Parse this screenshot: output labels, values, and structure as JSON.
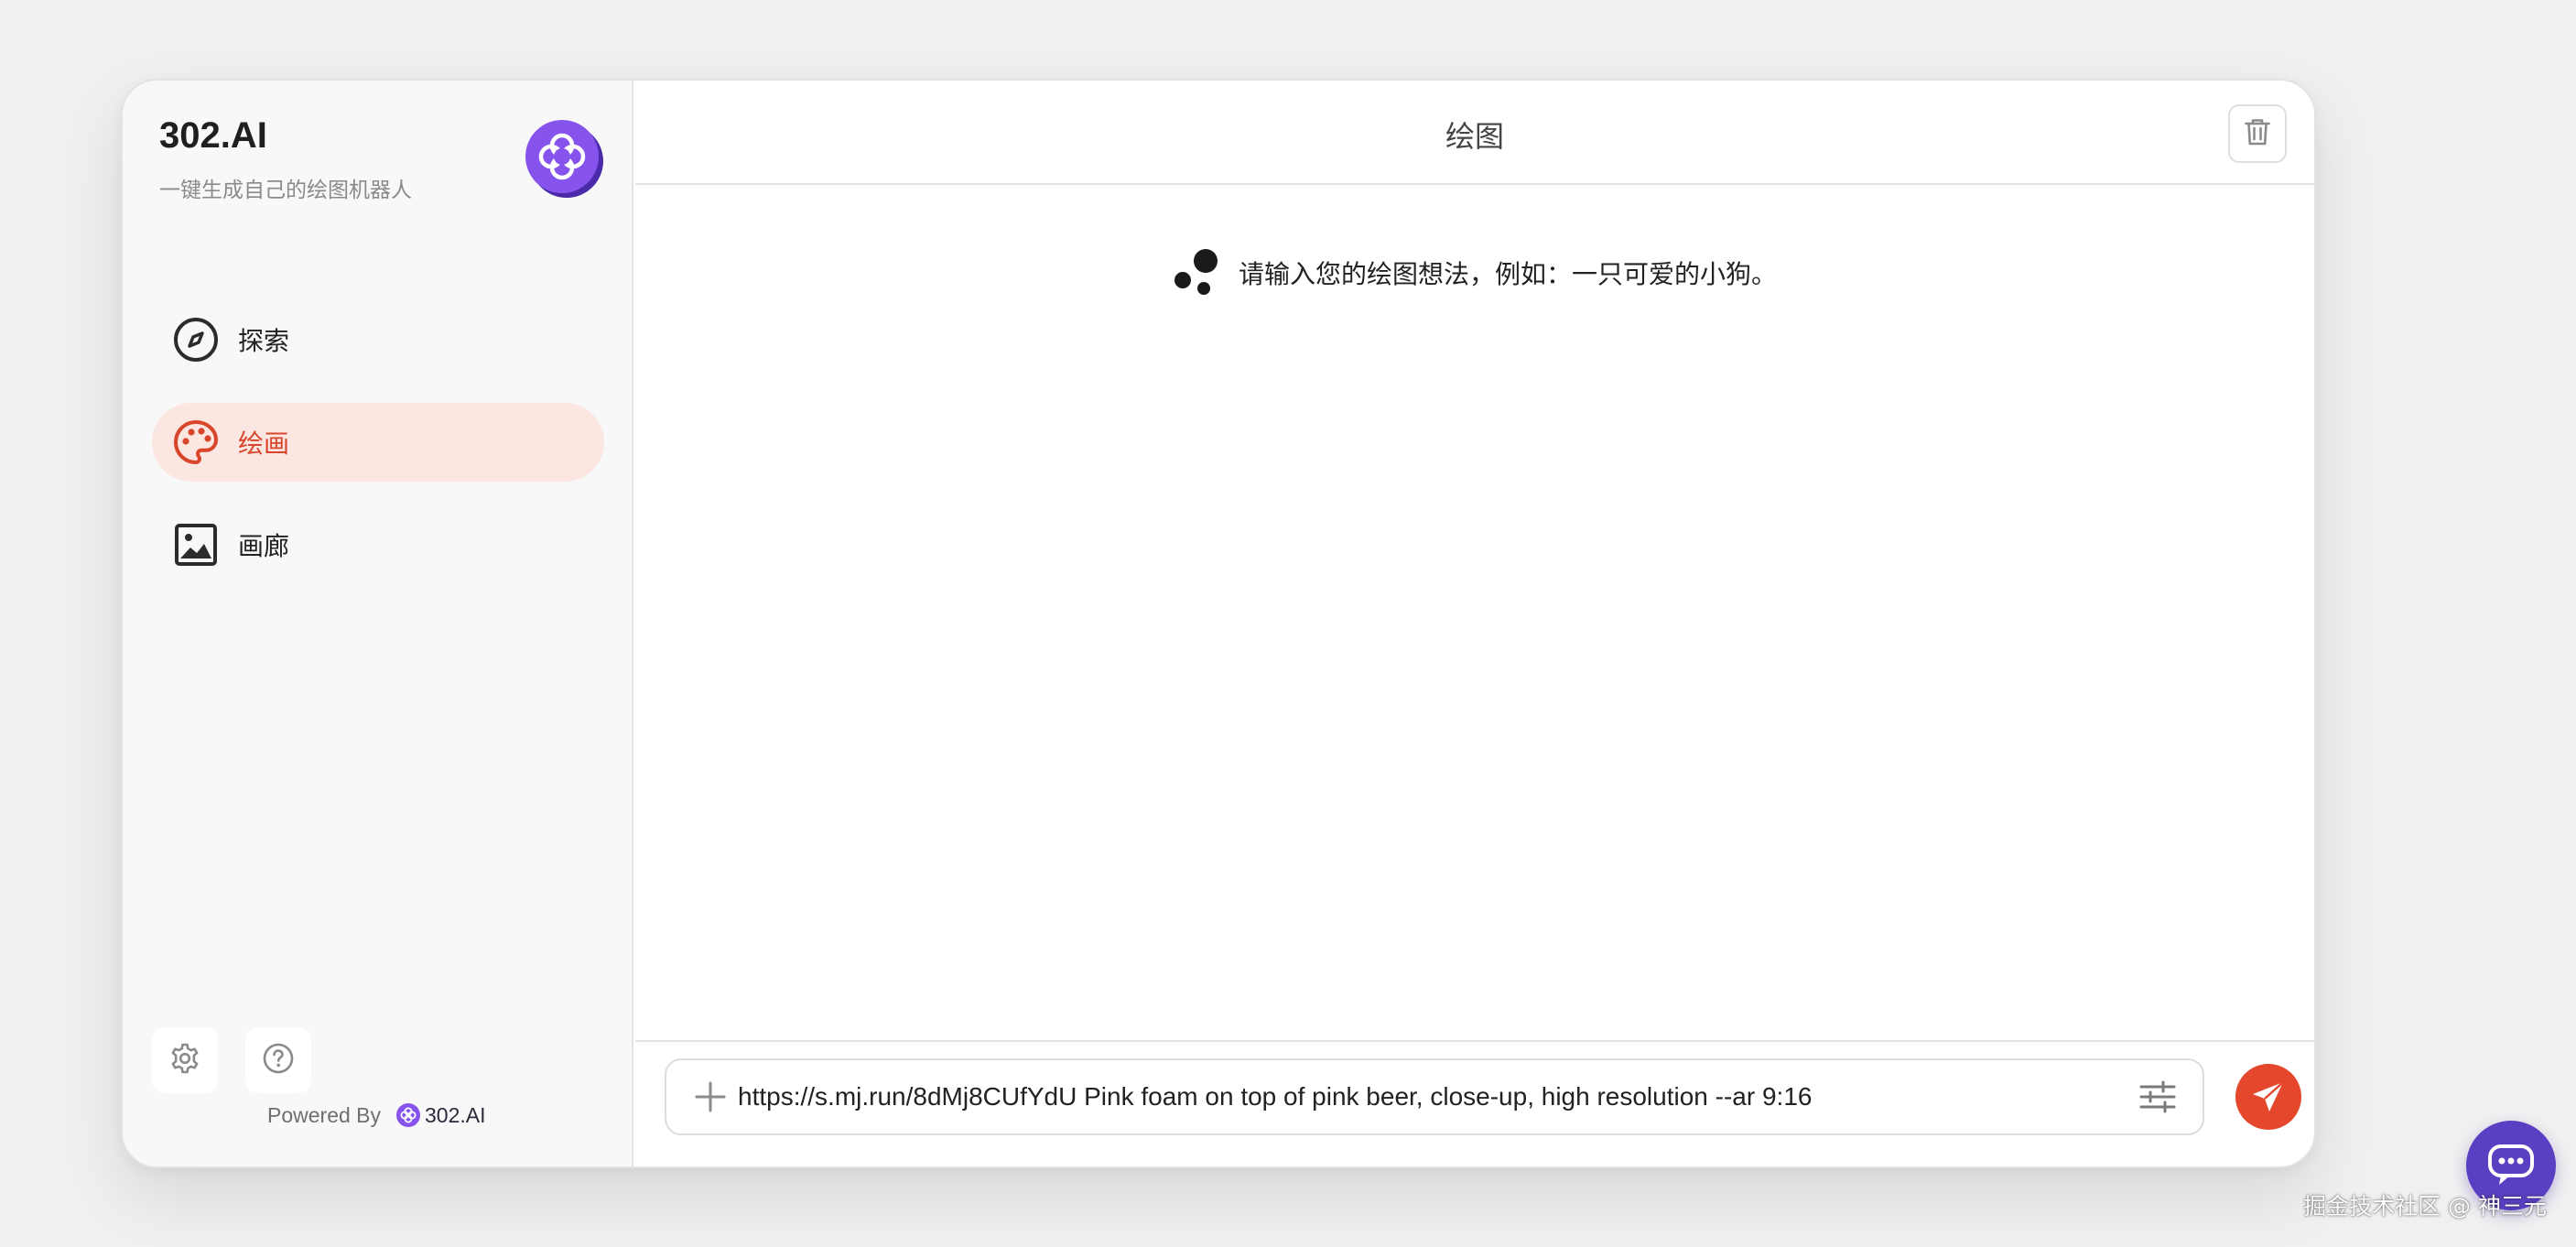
{
  "sidebar": {
    "brand_title": "302.AI",
    "brand_subtitle": "一键生成自己的绘图机器人",
    "nav": [
      {
        "label": "探索",
        "icon": "compass-icon",
        "active": false
      },
      {
        "label": "绘画",
        "icon": "palette-icon",
        "active": true
      },
      {
        "label": "画廊",
        "icon": "image-icon",
        "active": false
      }
    ],
    "settings_icon": "gear-icon",
    "help_icon": "question-icon",
    "powered_by": "Powered By",
    "powered_brand": "302.AI"
  },
  "main": {
    "title": "绘图",
    "hint": "请输入您的绘图想法，例如：一只可爱的小狗。",
    "input_value": "https://s.mj.run/8dMj8CUfYdU Pink foam on top of pink beer, close-up, high resolution --ar 9:16"
  },
  "watermark": "掘金技术社区 @ 神三元",
  "colors": {
    "accent": "#e4472b",
    "active_bg": "#fbe6e1",
    "brand_purple": "#7b4fe0",
    "chat_purple": "#5b3fc2"
  }
}
